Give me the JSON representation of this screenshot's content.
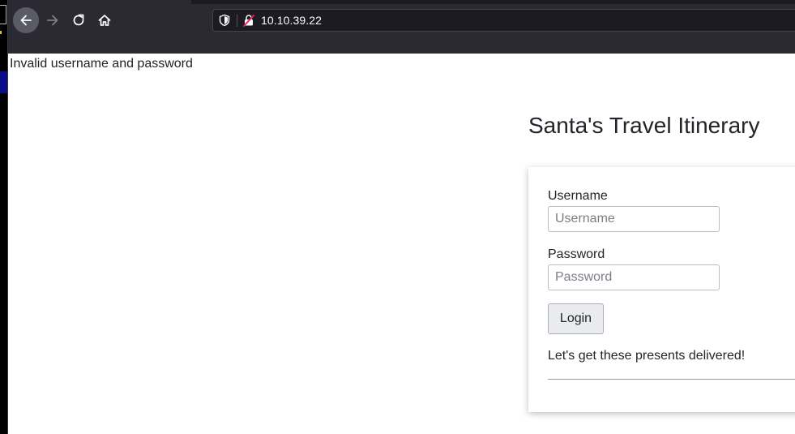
{
  "browser": {
    "url": "10.10.39.22",
    "icons": {
      "back": "arrow-left-icon",
      "forward": "arrow-right-icon",
      "reload": "reload-icon",
      "home": "home-icon",
      "tracking": "shield-icon",
      "connection": "insecure-lock-icon"
    }
  },
  "page": {
    "error_message": "Invalid username and password",
    "title": "Santa's Travel Itinerary",
    "form": {
      "username_label": "Username",
      "username_placeholder": "Username",
      "username_value": "",
      "password_label": "Password",
      "password_placeholder": "Password",
      "password_value": "",
      "login_label": "Login"
    },
    "tagline": "Let's get these presents delivered!"
  },
  "colors": {
    "chrome_bg": "#2b2a33",
    "urlbar_bg": "#1c1b22",
    "text": "#212529",
    "insecure_icon": "#e22850"
  }
}
